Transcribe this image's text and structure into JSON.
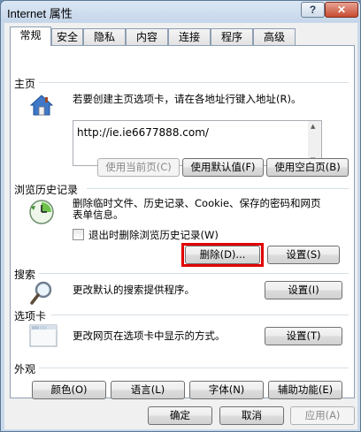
{
  "window": {
    "title": "Internet 属性",
    "help_label": "?",
    "close_label": "✕"
  },
  "tabs": [
    "常规",
    "安全",
    "隐私",
    "内容",
    "连接",
    "程序",
    "高级"
  ],
  "home": {
    "title": "主页",
    "description": "若要创建主页选项卡，请在各地址行键入地址(R)。",
    "url": "http://ie.ie6677888.com/",
    "use_current": "使用当前页(C)",
    "use_default": "使用默认值(F)",
    "use_blank": "使用空白页(B)"
  },
  "history": {
    "title": "浏览历史记录",
    "description_line1": "删除临时文件、历史记录、Cookie、保存的密码和网页",
    "description_line2": "表单信息。",
    "checkbox_label": "退出时删除浏览历史记录(W)",
    "delete_label": "删除(D)...",
    "settings_label": "设置(S)"
  },
  "search": {
    "title": "搜索",
    "description": "更改默认的搜索提供程序。",
    "settings_label": "设置(I)"
  },
  "tabs_section": {
    "title": "选项卡",
    "description": "更改网页在选项卡中显示的方式。",
    "settings_label": "设置(T)"
  },
  "appearance": {
    "title": "外观",
    "colors_label": "颜色(O)",
    "languages_label": "语言(L)",
    "fonts_label": "字体(N)",
    "accessibility_label": "辅助功能(E)"
  },
  "footer": {
    "ok_label": "确定",
    "cancel_label": "取消",
    "apply_label": "应用(A)"
  },
  "colors": {
    "highlight": "#e00000",
    "section_line": "#d5dfe5"
  }
}
